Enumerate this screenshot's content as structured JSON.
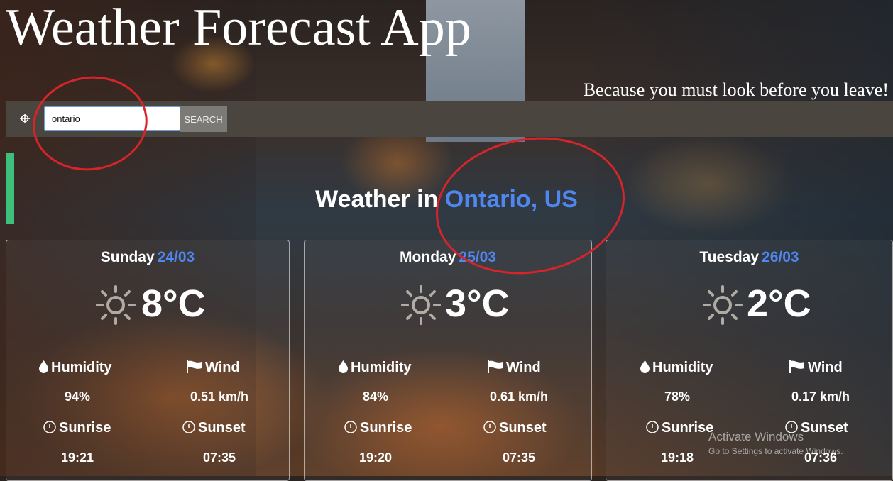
{
  "header": {
    "title": "Weather Forecast App",
    "tagline": "Because you must look before you leave!"
  },
  "search": {
    "value": "ontario",
    "button_label": "SEARCH"
  },
  "location_heading": {
    "prefix": "Weather in",
    "location": "Ontario, US"
  },
  "labels": {
    "humidity": "Humidity",
    "wind": "Wind",
    "sunrise": "Sunrise",
    "sunset": "Sunset"
  },
  "days": [
    {
      "day": "Sunday",
      "date": "24/03",
      "temp": "8°C",
      "humidity": "94%",
      "wind": "0.51 km/h",
      "sunrise": "19:21",
      "sunset": "07:35"
    },
    {
      "day": "Monday",
      "date": "25/03",
      "temp": "3°C",
      "humidity": "84%",
      "wind": "0.61 km/h",
      "sunrise": "19:20",
      "sunset": "07:35"
    },
    {
      "day": "Tuesday",
      "date": "26/03",
      "temp": "2°C",
      "humidity": "78%",
      "wind": "0.17 km/h",
      "sunrise": "19:18",
      "sunset": "07:36"
    }
  ],
  "watermark": {
    "line1": "Activate Windows",
    "line2": "Go to Settings to activate Windows."
  },
  "colors": {
    "accent": "#4f86ef",
    "annotation": "#d6242b",
    "search_bar": "#4a463f"
  }
}
